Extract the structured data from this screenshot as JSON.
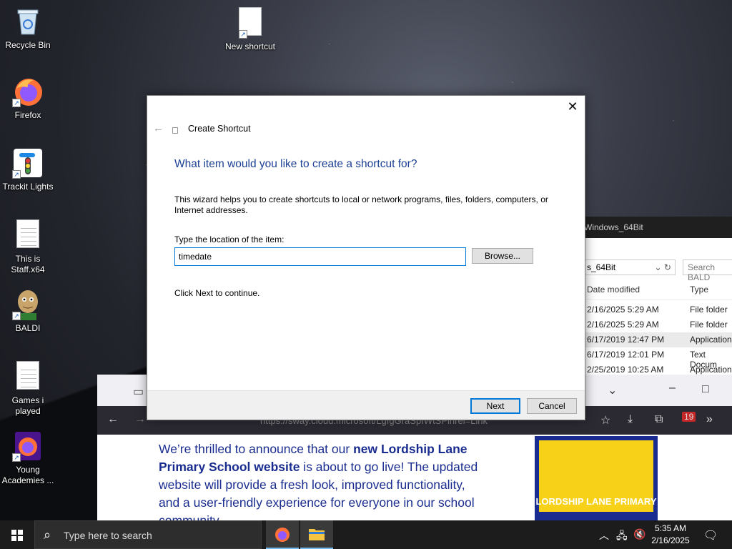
{
  "desktop": {
    "icons": [
      {
        "label": "Recycle Bin"
      },
      {
        "label": "Firefox"
      },
      {
        "label": "Trackit Lights"
      },
      {
        "label": "This is\nStaff.x64"
      },
      {
        "label": "BALDI"
      },
      {
        "label": "Games i\nplayed"
      },
      {
        "label": "Young\nAcademies ..."
      },
      {
        "label": "New shortcut"
      }
    ]
  },
  "explorer": {
    "title": "Windows_64Bit",
    "address": "s_64Bit",
    "search_placeholder": "Search BALD",
    "col_date": "Date modified",
    "col_type": "Type",
    "rows": [
      {
        "date": "2/16/2025 5:29 AM",
        "type": "File folder"
      },
      {
        "date": "2/16/2025 5:29 AM",
        "type": "File folder"
      },
      {
        "date": "6/17/2019 12:47 PM",
        "type": "Application"
      },
      {
        "date": "6/17/2019 12:01 PM",
        "type": "Text Docum"
      },
      {
        "date": "2/25/2019 10:25 AM",
        "type": "Application"
      }
    ]
  },
  "browser": {
    "url": "https://sway.cloud.microsoft/LgIgGraSpIWtSPlnrel=Link",
    "badge": "19",
    "news_prefix": "We’re thrilled to announce that our ",
    "news_bold": "new Lordship Lane Primary School website",
    "news_suffix": " is about to go live! The updated website will provide a fresh look, improved functionality, and a user-friendly experience for everyone in our school community.",
    "logo_text": "LORDSHIP LANE PRIMARY"
  },
  "dialog": {
    "title": "Create Shortcut",
    "heading": "What item would you like to create a shortcut for?",
    "description": "This wizard helps you to create shortcuts to local or network programs, files, folders, computers, or Internet addresses.",
    "location_label": "Type the location of the item:",
    "location_value": "timedate",
    "browse_label": "Browse...",
    "continue_text": "Click Next to continue.",
    "next_label": "Next",
    "cancel_label": "Cancel"
  },
  "taskbar": {
    "search_placeholder": "Type here to search",
    "time": "5:35 AM",
    "date": "2/16/2025"
  }
}
